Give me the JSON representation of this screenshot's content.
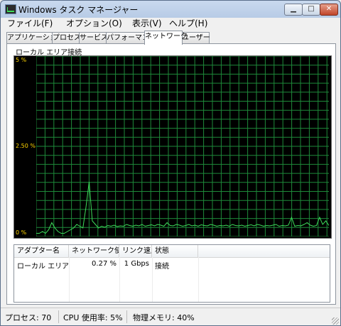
{
  "window": {
    "title": "Windows タスク マネージャー"
  },
  "menu": [
    "ファイル(F)",
    "オプション(O)",
    "表示(V)",
    "ヘルプ(H)"
  ],
  "tabs": [
    "アプリケーション",
    "プロセス",
    "サービス",
    "パフォーマンス",
    "ネットワーク",
    "ユーザー"
  ],
  "active_tab": "ネットワーク",
  "graph": {
    "label": "ローカル エリア接続",
    "scale_top": "5 %",
    "scale_mid": "2.50 %",
    "scale_bottom": "0 %",
    "grid_color": "#1e8a3a",
    "line_color": "#3ddc5a"
  },
  "table": {
    "headers": [
      "アダプター名",
      "ネットワーク使用...",
      "リンク速度",
      "状態"
    ],
    "rows": [
      [
        "ローカル エリア接...",
        "0.27 %",
        "1 Gbps",
        "接続"
      ]
    ]
  },
  "chart_data": {
    "type": "line",
    "ylim": [
      0,
      5
    ],
    "series": [
      {
        "values": [
          0.05,
          0.05,
          0.1,
          0.05,
          0.15,
          0.35,
          0.2,
          0.1,
          0.05,
          0.05,
          0.1,
          0.15,
          0.2,
          0.3,
          0.25,
          0.2,
          0.8,
          1.5,
          0.4,
          0.3,
          0.2,
          0.25,
          0.22,
          0.27,
          0.25,
          0.28,
          0.24,
          0.26,
          0.25,
          0.3,
          0.27,
          0.25,
          0.28,
          0.26,
          0.3,
          0.25,
          0.27,
          0.29,
          0.26,
          0.3,
          0.28,
          0.25,
          0.35,
          0.27,
          0.26,
          0.3,
          0.28,
          0.25,
          0.27,
          0.3,
          0.26,
          0.28,
          0.25,
          0.29,
          0.27,
          0.26,
          0.3,
          0.28,
          0.25,
          0.27,
          0.26,
          0.28,
          0.25,
          0.3,
          0.27,
          0.26,
          0.28,
          0.25,
          0.27,
          0.29,
          0.26,
          0.3,
          0.28,
          0.25,
          0.27,
          0.26,
          0.28,
          0.3,
          0.25,
          0.27,
          0.26,
          0.28,
          0.5,
          0.25,
          0.27,
          0.26,
          0.3,
          0.35,
          0.28,
          0.25,
          0.27,
          0.5,
          0.3,
          0.4,
          0.27
        ]
      }
    ]
  },
  "statusbar": {
    "processes": "プロセス: 70",
    "cpu": "CPU 使用率: 5%",
    "memory": "物理メモリ: 40%"
  }
}
